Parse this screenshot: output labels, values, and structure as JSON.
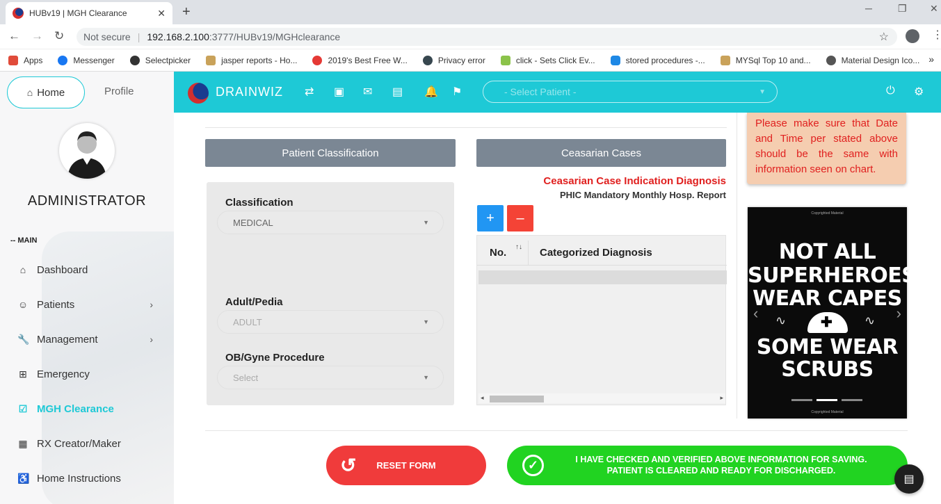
{
  "browser": {
    "tab_title": "HUBv19 | MGH Clearance",
    "not_secure": "Not secure",
    "url_host": "192.168.2.100",
    "url_path": ":3777/HUBv19/MGHclearance",
    "bookmarks": [
      "Apps",
      "Messenger",
      "Selectpicker",
      "jasper reports - Ho...",
      "2019's Best Free W...",
      "Privacy error",
      "click - Sets Click Ev...",
      "stored procedures -...",
      "MYSql Top 10 and...",
      "Material Design Ico..."
    ]
  },
  "sidebar": {
    "home_tab": "Home",
    "profile_tab": "Profile",
    "user_name": "ADMINISTRATOR",
    "section_label": "-- MAIN",
    "items": [
      {
        "label": "Dashboard"
      },
      {
        "label": "Patients"
      },
      {
        "label": "Management"
      },
      {
        "label": "Emergency"
      },
      {
        "label": "MGH Clearance"
      },
      {
        "label": "RX Creator/Maker"
      },
      {
        "label": "Home Instructions"
      }
    ]
  },
  "topbar": {
    "brand": "DRAINWIZ",
    "patient_select_placeholder": "- Select Patient -"
  },
  "classification": {
    "header": "Patient Classification",
    "classification_label": "Classification",
    "classification_value": "MEDICAL",
    "adult_label": "Adult/Pedia",
    "adult_value": "ADULT",
    "ob_label": "OB/Gyne Procedure",
    "ob_value": "Select"
  },
  "ceasarian": {
    "header": "Ceasarian Cases",
    "title": "Ceasarian Case Indication Diagnosis",
    "subtitle": "PHIC Mandatory Monthly Hosp. Report",
    "add_label": "+",
    "remove_label": "–",
    "columns": [
      "No.",
      "Categorized  Diagnosis"
    ]
  },
  "note": {
    "text": "Please make sure that Date and Time per stated above should be the same with information seen on chart."
  },
  "poster": {
    "copyright_top": "Copyrighted Material",
    "line1": "NOT ALL",
    "line2": "SUPERHEROES",
    "line3": "WEAR CAPES",
    "line4": "SOME WEAR",
    "line5": "SCRUBS",
    "copyright_bottom": "Copyrighted Material"
  },
  "actions": {
    "reset_label": "RESET FORM",
    "verify_line1": "I HAVE CHECKED AND VERIFIED ABOVE INFORMATION FOR SAVING.",
    "verify_line2": "PATIENT IS CLEARED AND READY FOR DISCHARGED."
  },
  "colors": {
    "accent": "#1ec9d6",
    "danger": "#f03b3b",
    "success": "#21d321",
    "section_header": "#7b8794"
  }
}
